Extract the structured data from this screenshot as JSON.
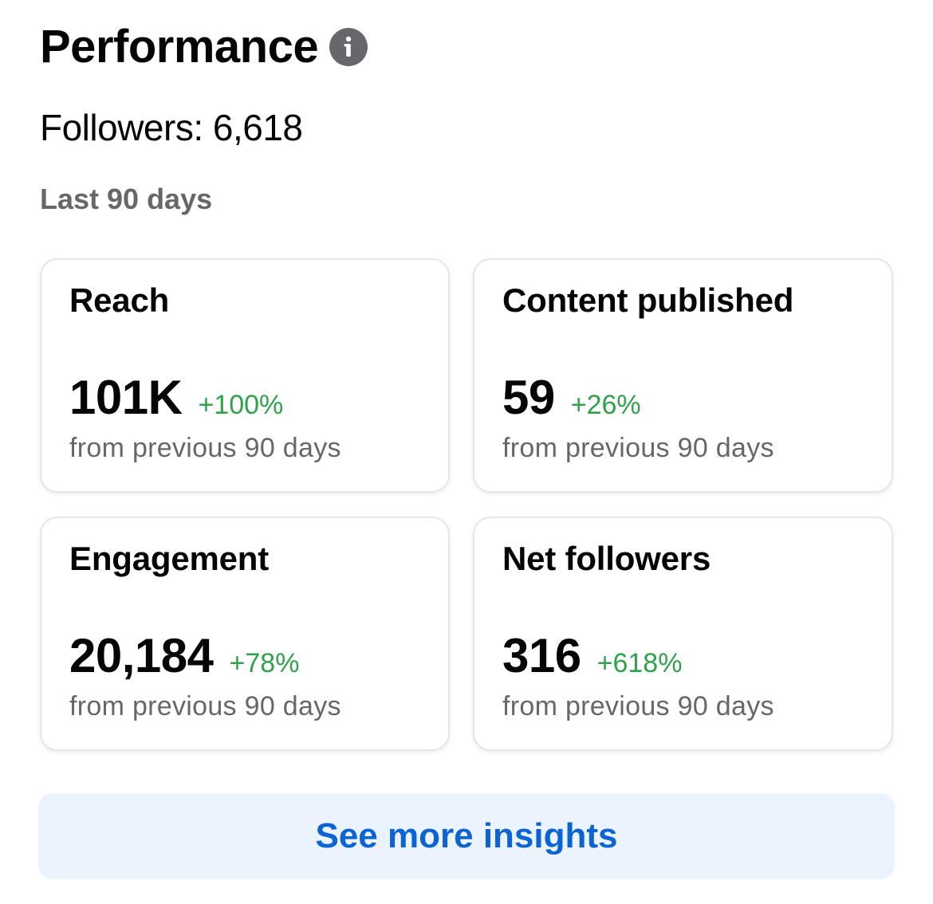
{
  "header": {
    "title": "Performance",
    "info_icon": "info-icon"
  },
  "followers": {
    "text": "Followers: 6,618"
  },
  "period": {
    "label": "Last 90 days"
  },
  "colors": {
    "positive_change": "#31a24c",
    "link": "#0c64d4",
    "cta_background": "#ebf3fe",
    "secondary_text": "#65676b"
  },
  "cards": [
    {
      "label": "Reach",
      "value": "101K",
      "change": "+100%",
      "caption": "from previous 90 days"
    },
    {
      "label": "Content published",
      "value": "59",
      "change": "+26%",
      "caption": "from previous 90 days"
    },
    {
      "label": "Engagement",
      "value": "20,184",
      "change": "+78%",
      "caption": "from previous 90 days"
    },
    {
      "label": "Net followers",
      "value": "316",
      "change": "+618%",
      "caption": "from previous 90 days"
    }
  ],
  "cta": {
    "label": "See more insights"
  }
}
